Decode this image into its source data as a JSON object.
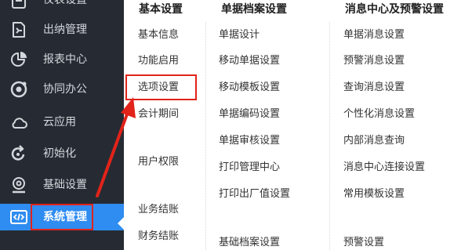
{
  "sidebar": {
    "items": [
      {
        "label": "仪表设置",
        "icon": "document-icon"
      },
      {
        "label": "出纳管理",
        "icon": "cashier-icon"
      },
      {
        "label": "报表中心",
        "icon": "pie-chart-icon"
      },
      {
        "label": "协同办公",
        "icon": "collaboration-icon"
      },
      {
        "label": "云应用",
        "icon": "cloud-icon"
      },
      {
        "label": "初始化",
        "icon": "refresh-icon"
      },
      {
        "label": "基础设置",
        "icon": "settings-icon"
      },
      {
        "label": "系统管理",
        "icon": "code-icon"
      }
    ],
    "active_index": 7
  },
  "columns": [
    {
      "title": "基本设置",
      "items": [
        "基本信息",
        "功能启用",
        "选项设置",
        "会计期间",
        "用户权限",
        "业务结账",
        "财务结账"
      ]
    },
    {
      "title": "单据档案设置",
      "items": [
        "单据设计",
        "移动单据设置",
        "移动模板设置",
        "单据编码设置",
        "单据审核设置",
        "打印管理中心",
        "打印出厂值设置",
        "基础档案设置"
      ]
    },
    {
      "title": "消息中心及预警设置",
      "items": [
        "单据消息设置",
        "预警消息设置",
        "查询消息设置",
        "个性化消息设置",
        "内部消息查询",
        "消息中心连接设置",
        "常用模板设置",
        "预警设置"
      ]
    }
  ],
  "colors": {
    "sidebar_bg": "#262b33",
    "active_bg": "#2f8cf0",
    "highlight": "#e2231a"
  }
}
